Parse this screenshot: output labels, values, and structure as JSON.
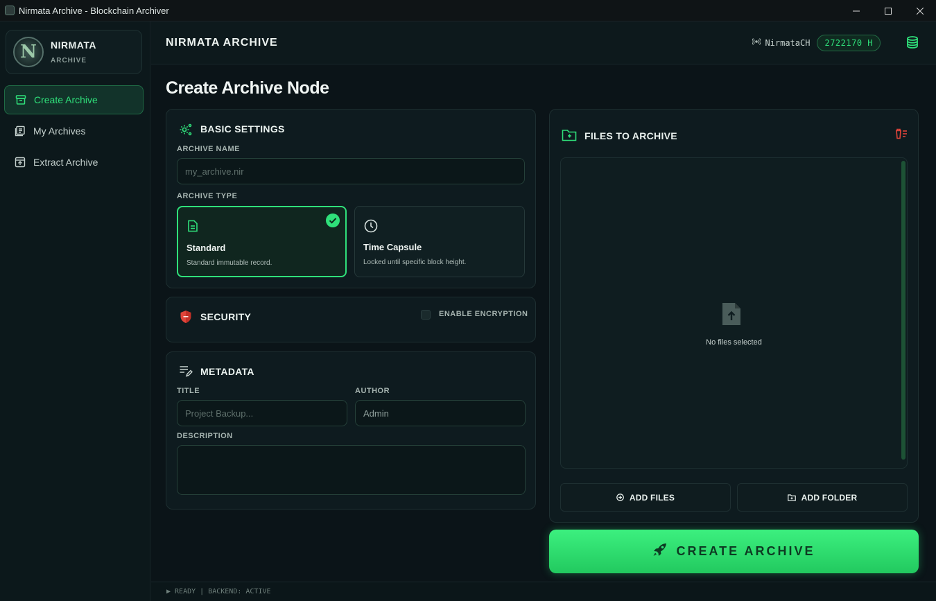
{
  "window": {
    "title": "Nirmata Archive - Blockchain Archiver",
    "controls": [
      "minimize-icon",
      "maximize-icon",
      "close-icon"
    ]
  },
  "sidebar": {
    "brand_name": "NIRMATA",
    "brand_sub": "ARCHIVE",
    "items": [
      {
        "label": "Create Archive",
        "icon": "archive-box-icon",
        "active": true
      },
      {
        "label": "My Archives",
        "icon": "list-document-icon",
        "active": false
      },
      {
        "label": "Extract Archive",
        "icon": "extract-box-icon",
        "active": false
      }
    ]
  },
  "header": {
    "app_name": "NIRMATA ARCHIVE",
    "node_name": "NirmataCH",
    "block_height": "2722170 H",
    "icons": [
      "signal-icon",
      "database-icon"
    ]
  },
  "page_title": "Create Archive Node",
  "basic_settings": {
    "title": "BASIC SETTINGS",
    "archive_name_label": "ARCHIVE NAME",
    "archive_name_placeholder": "my_archive.nir",
    "archive_type_label": "ARCHIVE TYPE",
    "types": [
      {
        "name": "Standard",
        "desc": "Standard immutable record.",
        "selected": true
      },
      {
        "name": "Time Capsule",
        "desc": "Locked until specific block height.",
        "selected": false
      }
    ]
  },
  "security": {
    "title": "SECURITY",
    "encryption_label": "ENABLE ENCRYPTION",
    "encryption_enabled": false
  },
  "metadata": {
    "title": "METADATA",
    "title_label": "TITLE",
    "title_placeholder": "Project Backup...",
    "author_label": "AUTHOR",
    "author_value": "Admin",
    "description_label": "DESCRIPTION",
    "description_value": ""
  },
  "files": {
    "title": "FILES TO ARCHIVE",
    "empty_text": "No files selected",
    "add_files_label": "ADD FILES",
    "add_folder_label": "ADD FOLDER"
  },
  "create_button_label": "CREATE ARCHIVE",
  "status": "▶ READY | BACKEND: ACTIVE",
  "colors": {
    "accent": "#2fe07a",
    "background": "#0b1418",
    "card": "#0e1b1f",
    "danger": "#e0443a"
  }
}
